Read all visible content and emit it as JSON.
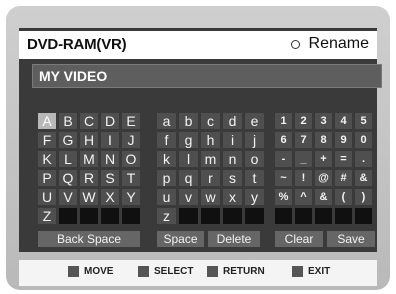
{
  "header": {
    "title": "DVD-RAM(VR)",
    "rename_label": "Rename"
  },
  "title_field": {
    "value": "MY VIDEO"
  },
  "keyboard": {
    "upper": [
      "A",
      "B",
      "C",
      "D",
      "E",
      "F",
      "G",
      "H",
      "I",
      "J",
      "K",
      "L",
      "M",
      "N",
      "O",
      "P",
      "Q",
      "R",
      "S",
      "T",
      "U",
      "V",
      "W",
      "X",
      "Y",
      "Z",
      "",
      "",
      "",
      ""
    ],
    "lower": [
      "a",
      "b",
      "c",
      "d",
      "e",
      "f",
      "g",
      "h",
      "i",
      "j",
      "k",
      "l",
      "m",
      "n",
      "o",
      "p",
      "q",
      "r",
      "s",
      "t",
      "u",
      "v",
      "w",
      "x",
      "y",
      "z",
      "",
      "",
      "",
      ""
    ],
    "symbols": [
      "1",
      "2",
      "3",
      "4",
      "5",
      "6",
      "7",
      "8",
      "9",
      "0",
      "-",
      "_",
      "+",
      "=",
      ".",
      "~",
      "!",
      "@",
      "#",
      "&",
      "%",
      "^",
      "&",
      "(",
      ")",
      "",
      "",
      "",
      "",
      ""
    ]
  },
  "actions": {
    "backspace": "Back Space",
    "space": "Space",
    "delete": "Delete",
    "clear": "Clear",
    "save": "Save"
  },
  "footer": {
    "move": "MOVE",
    "select": "SELECT",
    "return": "RETURN",
    "exit": "EXIT"
  }
}
